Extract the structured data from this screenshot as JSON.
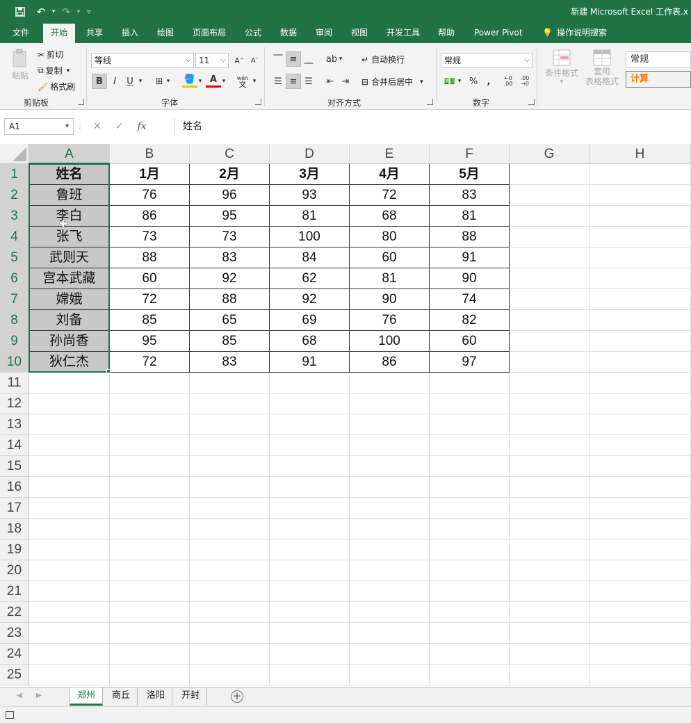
{
  "app": {
    "title": "新建 Microsoft Excel 工作表.x",
    "accent": "#217346"
  },
  "qat": {
    "save_icon": "save-icon",
    "undo_icon": "undo-icon",
    "redo_icon": "redo-icon",
    "customize_icon": "customize-icon"
  },
  "tabs": [
    "文件",
    "开始",
    "共享",
    "插入",
    "绘图",
    "页面布局",
    "公式",
    "数据",
    "审阅",
    "视图",
    "开发工具",
    "帮助",
    "Power Pivot",
    "操作说明搜索"
  ],
  "active_tab": "开始",
  "ribbon": {
    "clipboard": {
      "paste": "粘贴",
      "cut": "剪切",
      "copy": "复制",
      "format_painter": "格式刷",
      "label": "剪贴板"
    },
    "font": {
      "name": "等线",
      "size": "11",
      "bold": "B",
      "italic": "I",
      "underline": "U",
      "label": "字体",
      "wen": "wén",
      "wen_char": "文"
    },
    "alignment": {
      "wrap": "自动换行",
      "merge": "合并后居中",
      "label": "对齐方式"
    },
    "number": {
      "format": "常规",
      "percent": "%",
      "comma": ",",
      "inc_dec": "←0 .00",
      "dec_dec": ".00 →0",
      "label": "数字"
    },
    "styles": {
      "conditional": "条件格式",
      "table_format_1": "套用",
      "table_format_2": "表格格式",
      "normal": "常规",
      "calc": "计算"
    }
  },
  "formula_bar": {
    "name_box": "A1",
    "cancel": "✕",
    "enter": "✓",
    "fx": "fx",
    "content": "姓名"
  },
  "columns": [
    "A",
    "B",
    "C",
    "D",
    "E",
    "F",
    "G",
    "H"
  ],
  "rows": [
    "1",
    "2",
    "3",
    "4",
    "5",
    "6",
    "7",
    "8",
    "9",
    "10",
    "11",
    "12",
    "13",
    "14",
    "15",
    "16",
    "17",
    "18",
    "19",
    "20",
    "21",
    "22",
    "23",
    "24",
    "25"
  ],
  "table": {
    "header": [
      "姓名",
      "1月",
      "2月",
      "3月",
      "4月",
      "5月"
    ],
    "data": [
      [
        "鲁班",
        "76",
        "96",
        "93",
        "72",
        "83"
      ],
      [
        "李白",
        "86",
        "95",
        "81",
        "68",
        "81"
      ],
      [
        "张飞",
        "73",
        "73",
        "100",
        "80",
        "88"
      ],
      [
        "武则天",
        "88",
        "83",
        "84",
        "60",
        "91"
      ],
      [
        "宫本武藏",
        "60",
        "92",
        "62",
        "81",
        "90"
      ],
      [
        "嫦娥",
        "72",
        "88",
        "92",
        "90",
        "74"
      ],
      [
        "刘备",
        "85",
        "65",
        "69",
        "76",
        "82"
      ],
      [
        "孙尚香",
        "95",
        "85",
        "68",
        "100",
        "60"
      ],
      [
        "狄仁杰",
        "72",
        "83",
        "91",
        "86",
        "97"
      ]
    ]
  },
  "sheets": [
    "郑州",
    "商丘",
    "洛阳",
    "开封"
  ],
  "active_sheet": "郑州"
}
